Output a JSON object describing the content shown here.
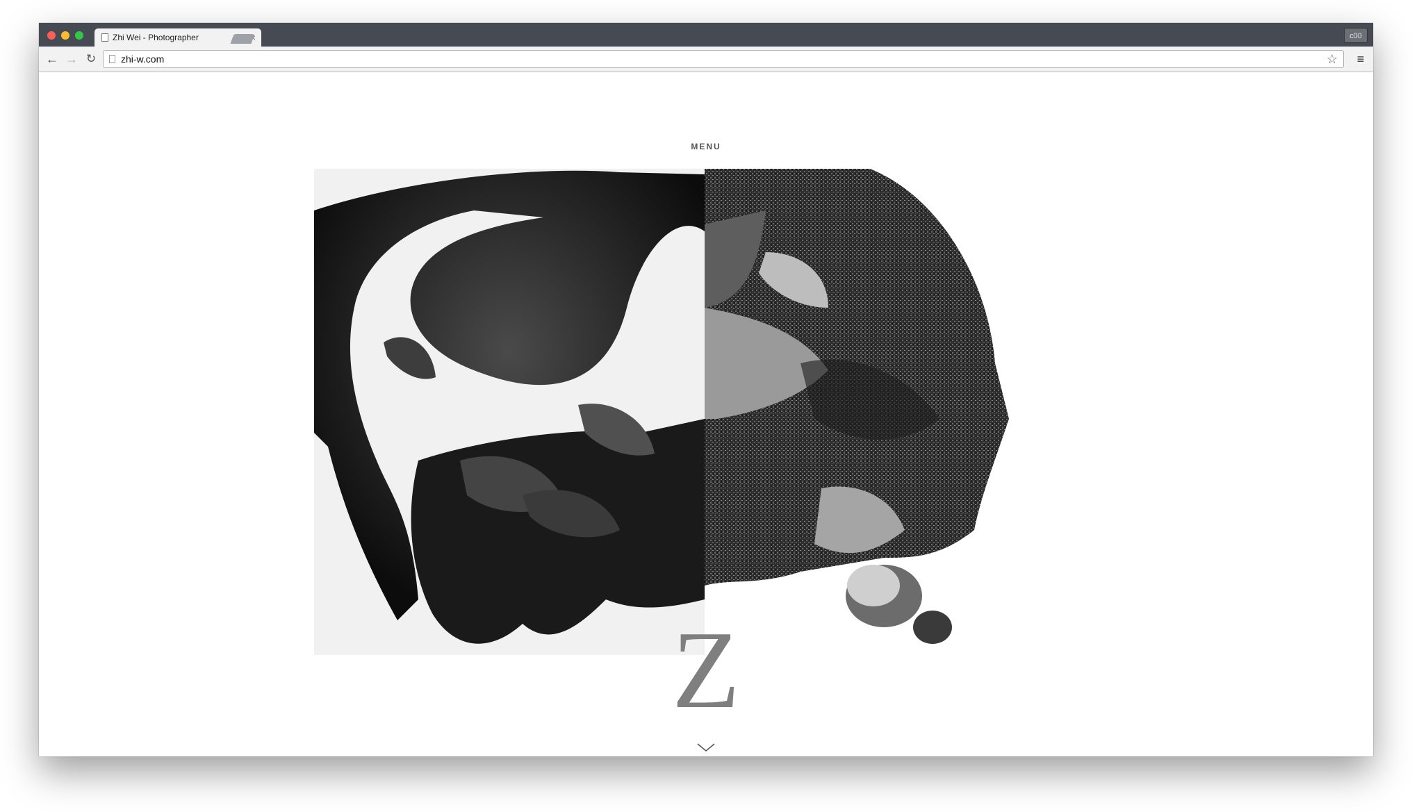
{
  "browser": {
    "tab_title": "Zhi Wei - Photographer",
    "tab_close": "×",
    "url": "zhi-w.com",
    "profile": "c00",
    "back": "←",
    "forward": "→",
    "reload": "↻",
    "star": "☆",
    "menu": "≡"
  },
  "site": {
    "menu_label": "MENU",
    "logo": "Z"
  }
}
